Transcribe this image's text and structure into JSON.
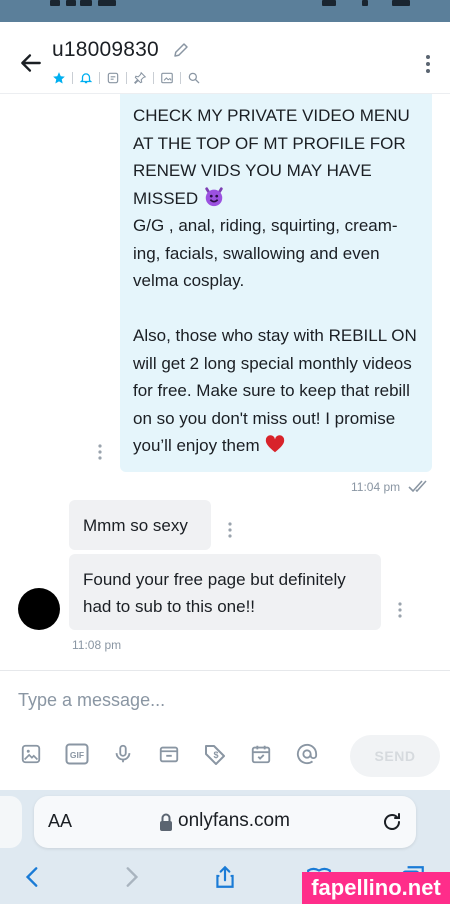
{
  "header": {
    "contact_name": "u18009830",
    "icons": [
      "star-icon",
      "bell-icon",
      "note-icon",
      "pin-icon",
      "image-icon",
      "search-icon"
    ]
  },
  "messages": {
    "outgoing": {
      "text": "CHECK MY PRIVATE VIDEO MENU AT THE TOP OF MT PROFILE FOR RENEW VIDS YOU MAY HAVE MISSED",
      "text2": "G/G , anal, riding, squirting, cream-ing, facials, swallowing and even velma cosplay.\n\nAlso, those who stay with REBILL ON will get 2 long special monthly videos for free. Make sure to keep that rebill on so you don't miss out! I promise you’ll enjoy them",
      "emoji_1": "smiling-imp-emoji",
      "emoji_2": "red-heart-emoji",
      "time": "11:04 pm"
    },
    "incoming": [
      {
        "text": "Mmm so sexy"
      },
      {
        "text": "Found your free page but definitely had to sub to this one!!"
      }
    ],
    "incoming_time": "11:08 pm"
  },
  "composer": {
    "placeholder": "Type a message...",
    "gif_label": "GIF",
    "send_label": "SEND",
    "tools": [
      "image-icon",
      "gif-icon",
      "microphone-icon",
      "vault-icon",
      "price-tag-icon",
      "calendar-icon",
      "mention-icon"
    ]
  },
  "browser": {
    "aa_label": "AA",
    "url": "onlyfans.com"
  },
  "watermark": "fapellino.net",
  "colors": {
    "accent": "#00aff0",
    "outgoing_bubble": "#e5f5fb",
    "incoming_bubble": "#f0f1f3",
    "watermark_bg": "#ff2d8a"
  }
}
